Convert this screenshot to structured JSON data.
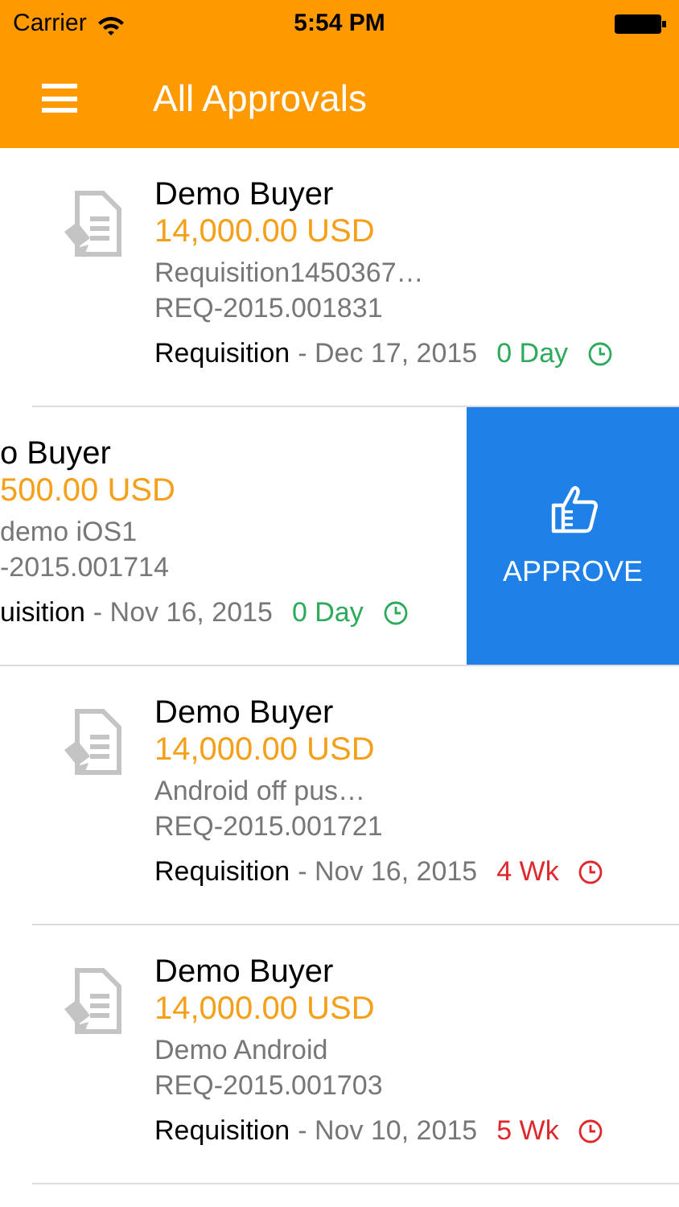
{
  "status_bar": {
    "carrier": "Carrier",
    "time": "5:54 PM"
  },
  "header": {
    "title": "All Approvals"
  },
  "approvals": [
    {
      "kind": "normal",
      "name": "Demo Buyer",
      "amount": "14,000.00 USD",
      "description": "Requisition1450367…",
      "number": "REQ-2015.001831",
      "type": "Requisition",
      "date": "- Dec 17, 2015",
      "age": "0 Day",
      "color": "#2eaa5c"
    },
    {
      "kind": "swiped",
      "name": "o Buyer",
      "amount": "500.00 USD",
      "description": "demo iOS1",
      "number": "-2015.001714",
      "type": "uisition",
      "date": "- Nov 16, 2015",
      "age": "0 Day",
      "color": "#2eaa5c",
      "action": "APPROVE"
    },
    {
      "kind": "normal",
      "name": "Demo Buyer",
      "amount": "14,000.00 USD",
      "description": "Android off pus…",
      "number": "REQ-2015.001721",
      "type": "Requisition",
      "date": "- Nov 16, 2015",
      "age": "4 Wk",
      "color": "#e0272c"
    },
    {
      "kind": "normal",
      "name": "Demo Buyer",
      "amount": "14,000.00 USD",
      "description": "Demo Android",
      "number": "REQ-2015.001703",
      "type": "Requisition",
      "date": "- Nov 10, 2015",
      "age": "5 Wk",
      "color": "#e0272c"
    }
  ]
}
